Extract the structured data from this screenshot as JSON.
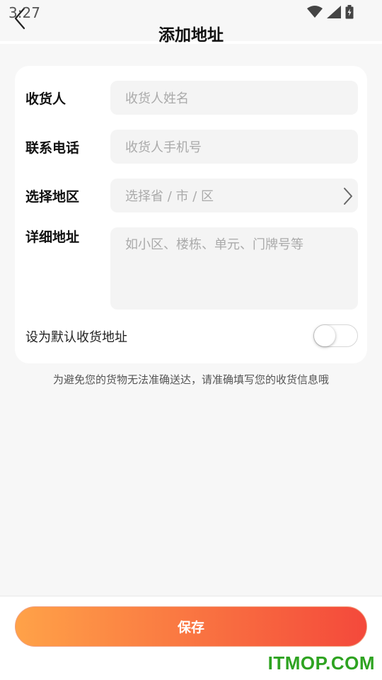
{
  "status_bar": {
    "time": "3:27",
    "icons": [
      "wifi-icon",
      "signal-icon",
      "battery-icon"
    ]
  },
  "header": {
    "title": "添加地址",
    "back_icon": "chevron-left-icon"
  },
  "form": {
    "fields": [
      {
        "label": "收货人",
        "placeholder": "收货人姓名"
      },
      {
        "label": "联系电话",
        "placeholder": "收货人手机号"
      },
      {
        "label": "选择地区",
        "placeholder": "选择省 / 市 / 区",
        "icon": "chevron-right-icon"
      },
      {
        "label": "详细地址",
        "placeholder": "如小区、楼栋、单元、门牌号等"
      }
    ],
    "default_address": {
      "label": "设为默认收货地址",
      "enabled": false
    }
  },
  "hint": "为避免您的货物无法准确送达，请准确填写您的收货信息哦",
  "footer": {
    "save_label": "保存"
  },
  "watermark": "ITMOP.COM",
  "colors": {
    "background": "#f7f7f7",
    "card": "#ffffff",
    "field_bg": "#f4f4f4",
    "placeholder": "#aaaaaa",
    "button_gradient_start": "#ffa248",
    "button_gradient_end": "#f4493b",
    "watermark": "#2ea321"
  }
}
